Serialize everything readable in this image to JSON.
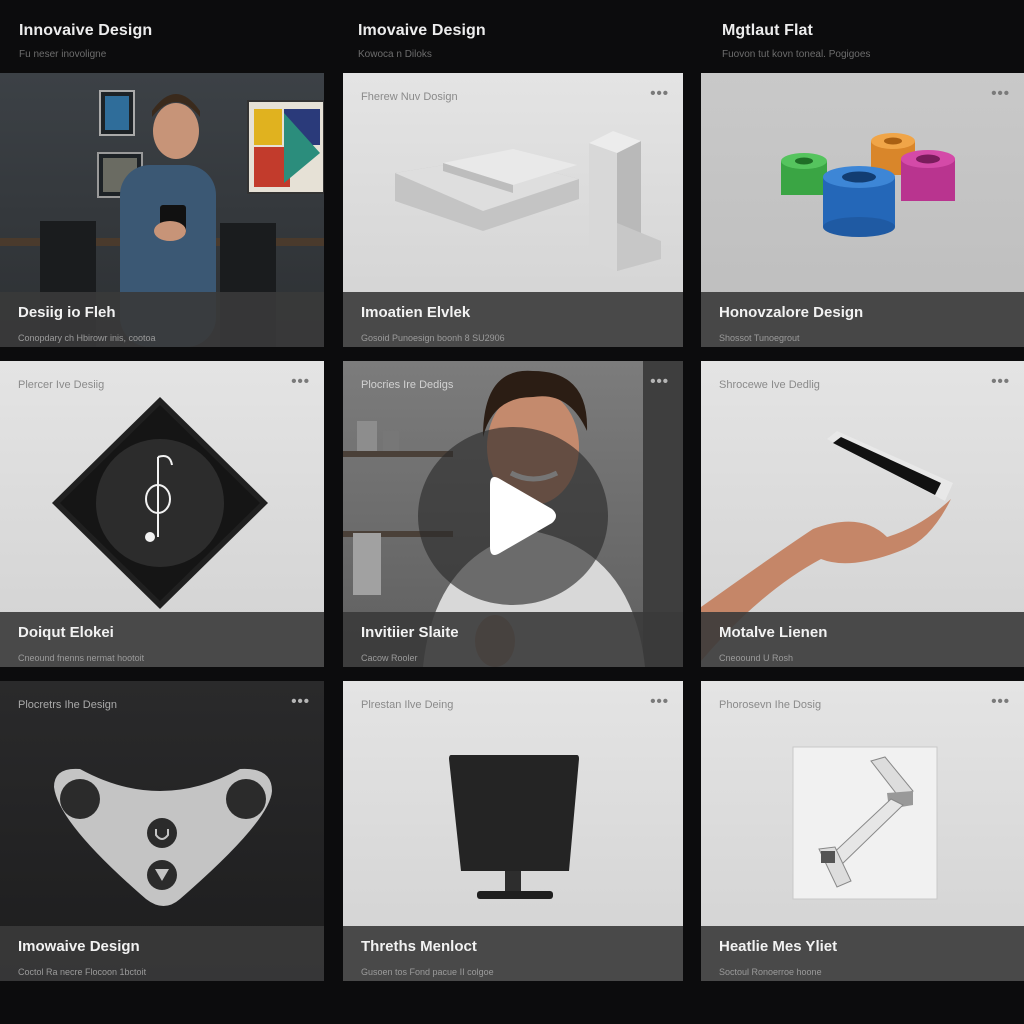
{
  "columns": [
    {
      "title": "Innovaive Design",
      "subtitle": "Fu neser inovoligne"
    },
    {
      "title": "Imovaive Design",
      "subtitle": "Kowoca n Diloks"
    },
    {
      "title": "Mgtlaut Flat",
      "subtitle": "Fuovon tut kovn toneal. Pogigoes"
    }
  ],
  "cards": [
    {
      "title": "Desiig io Fleh",
      "subtitle": "Conopdary ch Hbirowr inis, cootoa",
      "tag": "",
      "has_more": false
    },
    {
      "title": "Imoatien Elvlek",
      "subtitle": "Gosoid Punoesign boonh 8 SU2906",
      "tag": "Fherew Nuv Dosign",
      "has_more": true
    },
    {
      "title": "Honovzalore Design",
      "subtitle": "Shossot Tunoegrout",
      "tag": "",
      "has_more": true
    },
    {
      "title": "Doiqut Elokei",
      "subtitle": "Cneound fnenns nermat hootoit",
      "tag": "Plercer Ive Desiig",
      "has_more": true
    },
    {
      "title": "Invitiier Slaite",
      "subtitle": "Cacow Rooler",
      "tag": "Plocries Ire Dedigs",
      "has_more": true
    },
    {
      "title": "Motalve Lienen",
      "subtitle": "Cneoound U Rosh",
      "tag": "Shrocewe Ive Dedlig",
      "has_more": true
    },
    {
      "title": "Imowaive Design",
      "subtitle": "Coctol Ra necre Flocoon 1bctoit",
      "tag": "Plocretrs Ihe Design",
      "has_more": true
    },
    {
      "title": "Threths Menloct",
      "subtitle": "Gusoen tos Fond pacue II colgoe",
      "tag": "Plrestan Ilve Deing",
      "has_more": true
    },
    {
      "title": "Heatlie Mes Yliet",
      "subtitle": "Soctoul Ronoerroe hoone",
      "tag": "Phorosevn Ihe Dosig",
      "has_more": true
    }
  ],
  "more_glyph": "•••",
  "colors": {
    "page_bg": "#0c0c0d",
    "caption_bg": "#3a3a3a",
    "accent_green": "#3db34a",
    "accent_orange": "#e08a23",
    "accent_blue": "#2a6fc4",
    "accent_pink": "#c63b9c"
  }
}
